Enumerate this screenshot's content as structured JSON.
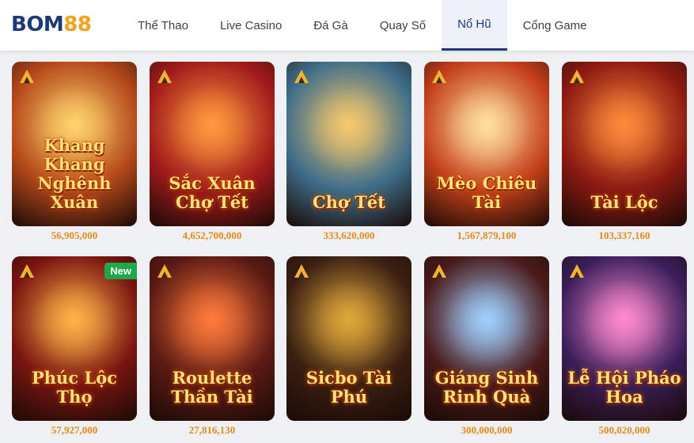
{
  "logo": {
    "part1": "BOM",
    "part2": "88"
  },
  "nav": [
    {
      "label": "Thể Thao"
    },
    {
      "label": "Live Casino"
    },
    {
      "label": "Đá Gà"
    },
    {
      "label": "Quay Số"
    },
    {
      "label": "Nổ Hũ"
    },
    {
      "label": "Cổng Game"
    }
  ],
  "active_nav": "Nổ Hũ",
  "games": [
    {
      "title": "Khang Khang Nghênh Xuân",
      "amount": "56,905,000",
      "bg": "#b3471a",
      "glow": "#ffd36b"
    },
    {
      "title": "Sắc Xuân Chợ Tết",
      "amount": "4,652,700,000",
      "bg": "#a31b1b",
      "glow": "#ff9a3d"
    },
    {
      "title": "Chợ Tết",
      "amount": "333,620,000",
      "bg": "#3f6e8a",
      "glow": "#f7c86b"
    },
    {
      "title": "Mèo Chiêu Tài",
      "amount": "1,567,879,100",
      "bg": "#c4401a",
      "glow": "#ffe0a0"
    },
    {
      "title": "Tài Lộc",
      "amount": "103,337,160",
      "bg": "#8c1a12",
      "glow": "#ff8a3a"
    },
    {
      "title": "Phúc Lộc Thọ",
      "amount": "57,927,000",
      "bg": "#7a1510",
      "glow": "#ffb347",
      "badge": "New"
    },
    {
      "title": "Roulette Thần Tài",
      "amount": "27,816,130",
      "bg": "#5c1a14",
      "glow": "#ff7a3a"
    },
    {
      "title": "Sicbo Tài Phú",
      "amount": "",
      "bg": "#3a1f12",
      "glow": "#e0a83a"
    },
    {
      "title": "Giáng Sinh Rinh Quà",
      "amount": "300,000,000",
      "bg": "#4a1a1a",
      "glow": "#9fd0ff"
    },
    {
      "title": "Lễ Hội Pháo Hoa",
      "amount": "500,020,000",
      "bg": "#3a1e5a",
      "glow": "#ff8ad0"
    }
  ],
  "colors": {
    "brand_dark": "#1d3a78",
    "brand_orange": "#f0a318",
    "amount": "#e08a1c",
    "new_badge": "#1fa84a"
  }
}
